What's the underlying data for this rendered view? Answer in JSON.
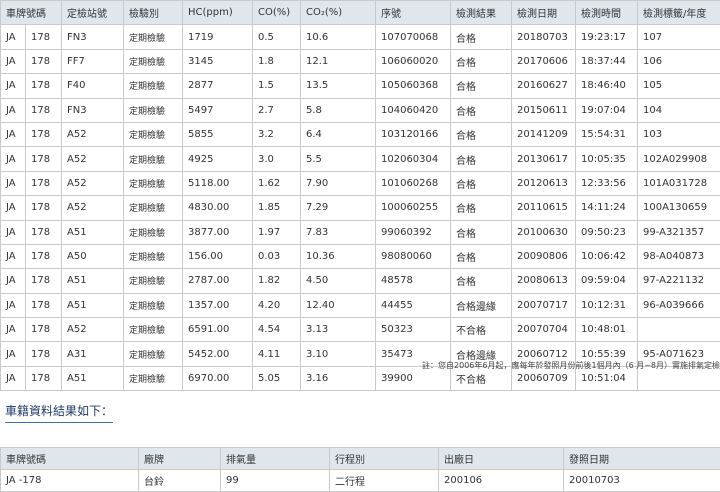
{
  "inspection_table": {
    "headers": [
      "車牌號碼",
      "定檢站號",
      "檢驗別",
      "HC(ppm)",
      "CO(%)",
      "CO₂(%)",
      "序號",
      "檢測結果",
      "檢測日期",
      "檢測時間",
      "檢測標籤/年度"
    ],
    "rows": [
      [
        "JA",
        "178",
        "FN3",
        "定期檢驗",
        "1719",
        "0.5",
        "10.6",
        "107070068",
        "合格",
        "20180703",
        "19:23:17",
        "107"
      ],
      [
        "JA",
        "178",
        "FF7",
        "定期檢驗",
        "3145",
        "1.8",
        "12.1",
        "106060020",
        "合格",
        "20170606",
        "18:37:44",
        "106"
      ],
      [
        "JA",
        "178",
        "F40",
        "定期檢驗",
        "2877",
        "1.5",
        "13.5",
        "105060368",
        "合格",
        "20160627",
        "18:46:40",
        "105"
      ],
      [
        "JA",
        "178",
        "FN3",
        "定期檢驗",
        "5497",
        "2.7",
        "5.8",
        "104060420",
        "合格",
        "20150611",
        "19:07:04",
        "104"
      ],
      [
        "JA",
        "178",
        "A52",
        "定期檢驗",
        "5855",
        "3.2",
        "6.4",
        "103120166",
        "合格",
        "20141209",
        "15:54:31",
        "103"
      ],
      [
        "JA",
        "178",
        "A52",
        "定期檢驗",
        "4925",
        "3.0",
        "5.5",
        "102060304",
        "合格",
        "20130617",
        "10:05:35",
        "102A029908"
      ],
      [
        "JA",
        "178",
        "A52",
        "定期檢驗",
        "5118.00",
        "1.62",
        "7.90",
        "101060268",
        "合格",
        "20120613",
        "12:33:56",
        "101A031728"
      ],
      [
        "JA",
        "178",
        "A52",
        "定期檢驗",
        "4830.00",
        "1.85",
        "7.29",
        "100060255",
        "合格",
        "20110615",
        "14:11:24",
        "100A130659"
      ],
      [
        "JA",
        "178",
        "A51",
        "定期檢驗",
        "3877.00",
        "1.97",
        "7.83",
        "99060392",
        "合格",
        "20100630",
        "09:50:23",
        "99-A321357"
      ],
      [
        "JA",
        "178",
        "A50",
        "定期檢驗",
        "156.00",
        "0.03",
        "10.36",
        "98080060",
        "合格",
        "20090806",
        "10:06:42",
        "98-A040873"
      ],
      [
        "JA",
        "178",
        "A51",
        "定期檢驗",
        "2787.00",
        "1.82",
        "4.50",
        "48578",
        "合格",
        "20080613",
        "09:59:04",
        "97-A221132"
      ],
      [
        "JA",
        "178",
        "A51",
        "定期檢驗",
        "1357.00",
        "4.20",
        "12.40",
        "44455",
        "合格邊緣",
        "20070717",
        "10:12:31",
        "96-A039666"
      ],
      [
        "JA",
        "178",
        "A52",
        "定期檢驗",
        "6591.00",
        "4.54",
        "3.13",
        "50323",
        "不合格",
        "20070704",
        "10:48:01",
        ""
      ],
      [
        "JA",
        "178",
        "A31",
        "定期檢驗",
        "5452.00",
        "4.11",
        "3.10",
        "35473",
        "合格邊緣",
        "20060712",
        "10:55:39",
        "95-A071623"
      ],
      [
        "JA",
        "178",
        "A51",
        "定期檢驗",
        "6970.00",
        "5.05",
        "3.16",
        "39900",
        "不合格",
        "20060709",
        "10:51:04",
        ""
      ]
    ]
  },
  "note": "註：您自2006年6月起，應每年於發照月份前後1個月內（6 月~8月）實施排氣定檢",
  "registration": {
    "title": "車籍資料結果如下：",
    "headers": [
      "車牌號碼",
      "廠牌",
      "排氣量",
      "行程別",
      "出廠日",
      "發照日期"
    ],
    "row": [
      "JA -178",
      "台鈴",
      "99",
      "二行程",
      "200106",
      "20010703"
    ]
  }
}
